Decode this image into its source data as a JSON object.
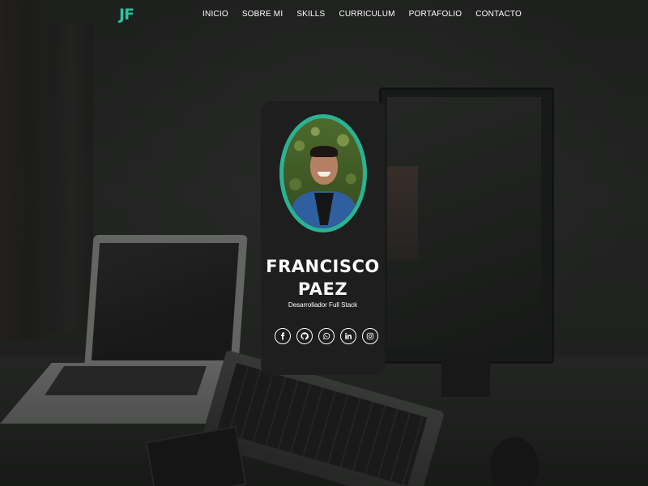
{
  "brand": {
    "logo_text": "JF",
    "accent_color": "#2ec4a0"
  },
  "nav": {
    "items": [
      {
        "label": "INICIO"
      },
      {
        "label": "SOBRE MI"
      },
      {
        "label": "SKILLS"
      },
      {
        "label": "CURRICULUM"
      },
      {
        "label": "PORTAFOLIO"
      },
      {
        "label": "CONTACTO"
      }
    ]
  },
  "profile": {
    "name_line1": "FRANCISCO",
    "name_line2": "PAEZ",
    "role": "Desarrollador Full Stack",
    "ring_color": "#2ab393",
    "card_color": "#1d1e1d"
  },
  "socials": [
    {
      "icon": "facebook-icon"
    },
    {
      "icon": "github-icon"
    },
    {
      "icon": "whatsapp-icon"
    },
    {
      "icon": "linkedin-icon"
    },
    {
      "icon": "instagram-icon"
    }
  ]
}
